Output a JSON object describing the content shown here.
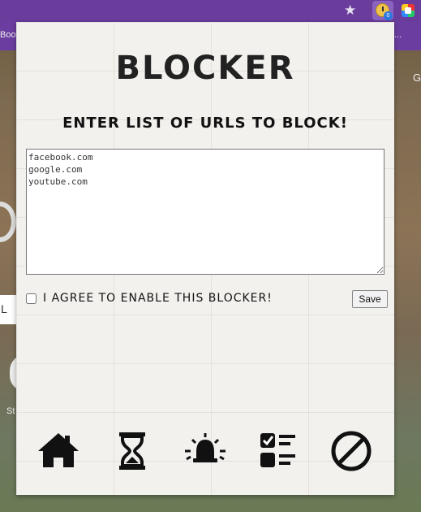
{
  "browser": {
    "bookmark_left": "Boo",
    "bookmark_right": "...",
    "star_icon": "★",
    "extension_badge": "0"
  },
  "background_page": {
    "side_g": "G",
    "side_l": "L",
    "side_st": "St"
  },
  "popup": {
    "title": "BLOCKER",
    "subtitle": "ENTER LIST OF URLS TO BLOCK!",
    "urls_value": "facebook.com\ngoogle.com\nyoutube.com",
    "agree_label": "I AGREE TO ENABLE THIS BLOCKER!",
    "agree_checked": false,
    "save_label": "Save"
  },
  "nav": {
    "items": [
      {
        "icon": "home-icon"
      },
      {
        "icon": "hourglass-icon"
      },
      {
        "icon": "alarm-bell-icon"
      },
      {
        "icon": "checklist-icon"
      },
      {
        "icon": "block-icon"
      }
    ]
  }
}
